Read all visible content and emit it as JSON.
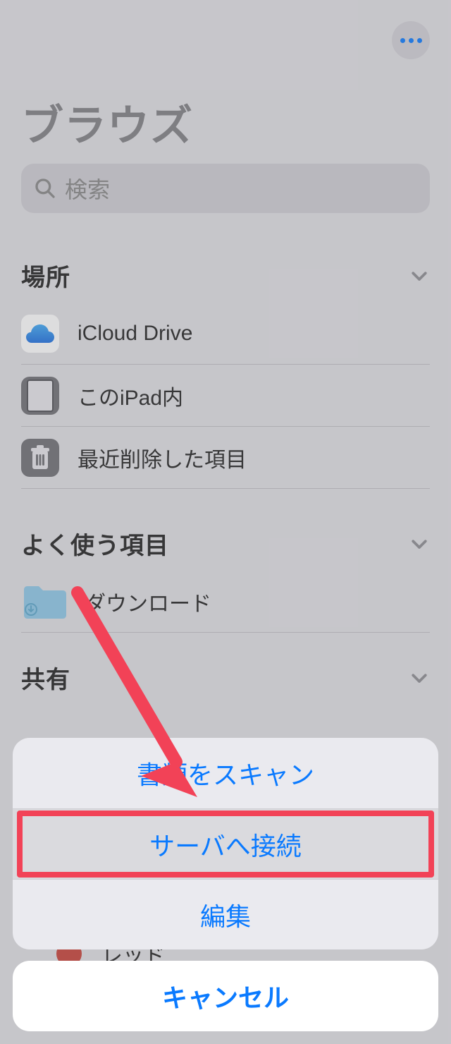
{
  "header": {
    "title": "ブラウズ",
    "search_placeholder": "検索"
  },
  "sections": {
    "locations": {
      "title": "場所",
      "items": [
        {
          "label": "iCloud Drive"
        },
        {
          "label": "このiPad内"
        },
        {
          "label": "最近削除した項目"
        }
      ]
    },
    "favorites": {
      "title": "よく使う項目",
      "items": [
        {
          "label": "ダウンロード"
        }
      ]
    },
    "shared": {
      "title": "共有"
    }
  },
  "tag": {
    "label": "レッド",
    "color": "#c94238"
  },
  "actionsheet": {
    "options": [
      "書類をスキャン",
      "サーバへ接続",
      "編集"
    ],
    "cancel": "キャンセル"
  }
}
